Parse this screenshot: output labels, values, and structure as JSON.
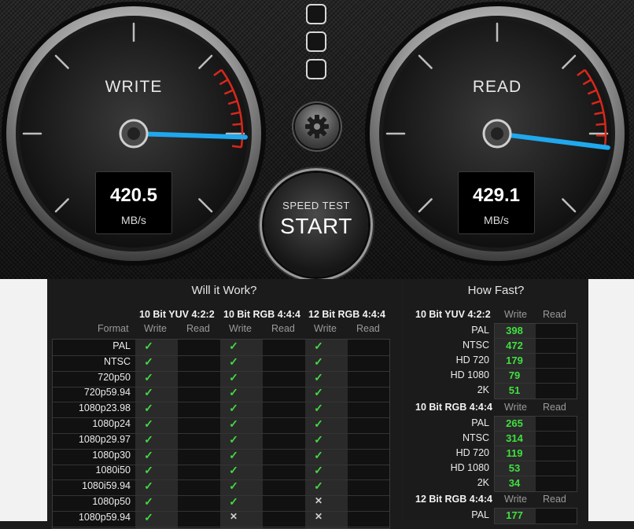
{
  "gauges": {
    "write": {
      "title": "WRITE",
      "value": "420.5",
      "unit": "MB/s",
      "needle_fraction": 0.84
    },
    "read": {
      "title": "READ",
      "value": "429.1",
      "unit": "MB/s",
      "needle_fraction": 0.86
    }
  },
  "controls": {
    "start_small": "SPEED TEST",
    "start_big": "START"
  },
  "will_it_work": {
    "title": "Will it Work?",
    "format_header": "Format",
    "groups": [
      {
        "name": "10 Bit YUV 4:2:2",
        "write": "Write",
        "read": "Read"
      },
      {
        "name": "10 Bit RGB 4:4:4",
        "write": "Write",
        "read": "Read"
      },
      {
        "name": "12 Bit RGB 4:4:4",
        "write": "Write",
        "read": "Read"
      }
    ],
    "rows": [
      {
        "format": "PAL",
        "marks": [
          "ok",
          "",
          "ok",
          "",
          "ok",
          ""
        ]
      },
      {
        "format": "NTSC",
        "marks": [
          "ok",
          "",
          "ok",
          "",
          "ok",
          ""
        ]
      },
      {
        "format": "720p50",
        "marks": [
          "ok",
          "",
          "ok",
          "",
          "ok",
          ""
        ]
      },
      {
        "format": "720p59.94",
        "marks": [
          "ok",
          "",
          "ok",
          "",
          "ok",
          ""
        ]
      },
      {
        "format": "1080p23.98",
        "marks": [
          "ok",
          "",
          "ok",
          "",
          "ok",
          ""
        ]
      },
      {
        "format": "1080p24",
        "marks": [
          "ok",
          "",
          "ok",
          "",
          "ok",
          ""
        ]
      },
      {
        "format": "1080p29.97",
        "marks": [
          "ok",
          "",
          "ok",
          "",
          "ok",
          ""
        ]
      },
      {
        "format": "1080p30",
        "marks": [
          "ok",
          "",
          "ok",
          "",
          "ok",
          ""
        ]
      },
      {
        "format": "1080i50",
        "marks": [
          "ok",
          "",
          "ok",
          "",
          "ok",
          ""
        ]
      },
      {
        "format": "1080i59.94",
        "marks": [
          "ok",
          "",
          "ok",
          "",
          "ok",
          ""
        ]
      },
      {
        "format": "1080p50",
        "marks": [
          "ok",
          "",
          "ok",
          "",
          "no",
          ""
        ]
      },
      {
        "format": "1080p59.94",
        "marks": [
          "ok",
          "",
          "no",
          "",
          "no",
          ""
        ]
      }
    ]
  },
  "how_fast": {
    "title": "How Fast?",
    "sections": [
      {
        "name": "10 Bit YUV 4:2:2",
        "write": "Write",
        "read": "Read",
        "rows": [
          {
            "format": "PAL",
            "write": "398"
          },
          {
            "format": "NTSC",
            "write": "472"
          },
          {
            "format": "HD 720",
            "write": "179"
          },
          {
            "format": "HD 1080",
            "write": "79"
          },
          {
            "format": "2K",
            "write": "51"
          }
        ]
      },
      {
        "name": "10 Bit RGB 4:4:4",
        "write": "Write",
        "read": "Read",
        "rows": [
          {
            "format": "PAL",
            "write": "265"
          },
          {
            "format": "NTSC",
            "write": "314"
          },
          {
            "format": "HD 720",
            "write": "119"
          },
          {
            "format": "HD 1080",
            "write": "53"
          },
          {
            "format": "2K",
            "write": "34"
          }
        ]
      },
      {
        "name": "12 Bit RGB 4:4:4",
        "write": "Write",
        "read": "Read",
        "rows": [
          {
            "format": "PAL",
            "write": "177"
          }
        ]
      }
    ]
  },
  "colors": {
    "needle": "#1fa8ee",
    "redline": "#d6281c",
    "ok": "#43d943",
    "speed_value": "#3fe03f"
  },
  "icons": {
    "settings": "gear-icon",
    "drive_slots": "drive-slot-icon",
    "ok": "checkmark-icon",
    "no": "x-icon"
  }
}
